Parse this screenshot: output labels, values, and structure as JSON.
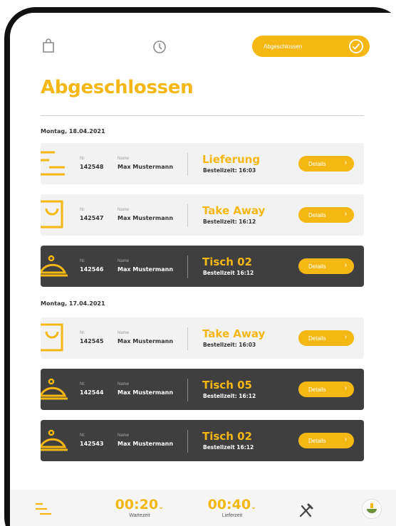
{
  "status": {
    "label": "Abgeschlossen"
  },
  "page": {
    "title": "Abgeschlossen"
  },
  "groups": [
    {
      "date": "Montag, 18.04.2021",
      "orders": [
        {
          "icon": "delivery-icon",
          "nr_label": "Nr.",
          "nr": "142548",
          "name_label": "Name",
          "name": "Max Mustermann",
          "type": "Lieferung",
          "time": "Bestellzeit: 16:03",
          "details": "Details",
          "dark": false
        },
        {
          "icon": "takeaway-bag-icon",
          "nr_label": "Nr.",
          "nr": "142547",
          "name_label": "Name",
          "name": "Max Mustermann",
          "type": "Take Away",
          "time": "Bestellzeit: 16:12",
          "details": "Details",
          "dark": false
        },
        {
          "icon": "cloche-icon",
          "nr_label": "Nr.",
          "nr": "142546",
          "name_label": "Name",
          "name": "Max Mustermann",
          "type": "Tisch 02",
          "time": "Bestellzeit 16:12",
          "details": "Details",
          "dark": true
        }
      ]
    },
    {
      "date": "Montag, 17.04.2021",
      "orders": [
        {
          "icon": "takeaway-bag-icon",
          "nr_label": "Nr.",
          "nr": "142545",
          "name_label": "Name",
          "name": "Max Mustermann",
          "type": "Take Away",
          "time": "Bestellzeit: 16:03",
          "details": "Details",
          "dark": false
        },
        {
          "icon": "cloche-icon",
          "nr_label": "Nr.",
          "nr": "142544",
          "name_label": "Name",
          "name": "Max Mustermann",
          "type": "Tisch 05",
          "time": "Bestellzeit: 16:12",
          "details": "Details",
          "dark": true
        },
        {
          "icon": "cloche-icon",
          "nr_label": "Nr.",
          "nr": "142543",
          "name_label": "Name",
          "name": "Max Mustermann",
          "type": "Tisch 02",
          "time": "Bestellzeit 16:12",
          "details": "Details",
          "dark": true
        }
      ]
    }
  ],
  "bottombar": {
    "wait_time": "00:20",
    "wait_label": "Wartezeit",
    "delivery_time": "00:40",
    "delivery_label": "Lieferzeit"
  },
  "colors": {
    "accent": "#f5b714",
    "dark_card": "#3f3f3f",
    "light_card": "#f2f2f2"
  }
}
